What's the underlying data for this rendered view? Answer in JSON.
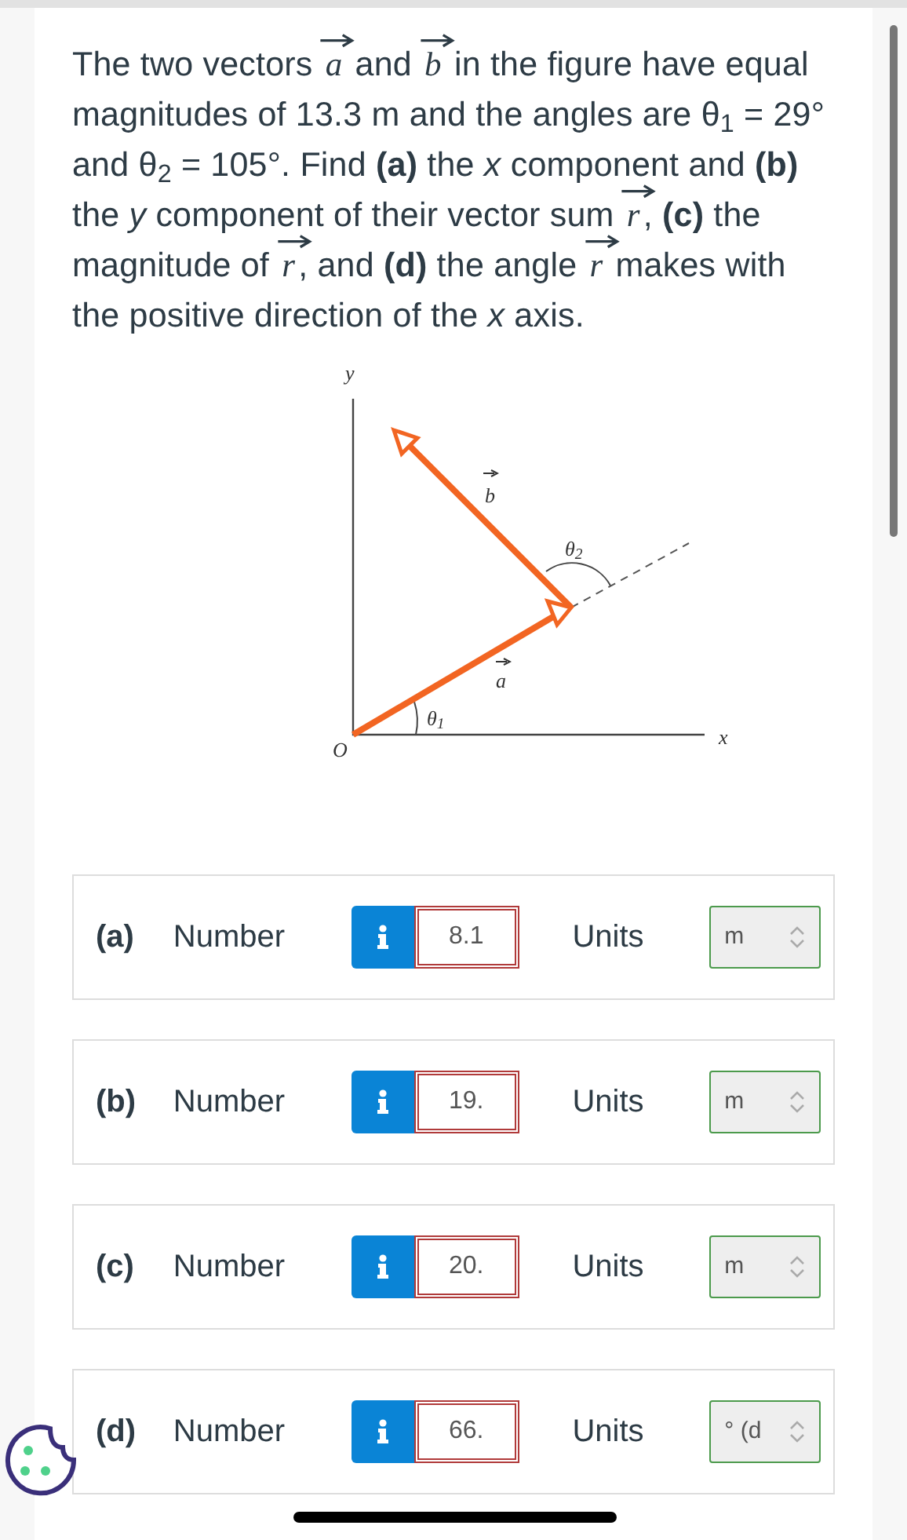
{
  "problem": [
    {
      "kind": "text",
      "text": "The two vectors "
    },
    {
      "kind": "vector",
      "symbol": "a"
    },
    {
      "kind": "text",
      "text": " and "
    },
    {
      "kind": "vector",
      "symbol": "b"
    },
    {
      "kind": "text",
      "text": " in the figure have equal magnitudes of 13.3 m and the angles are θ$_{1}$ = 29° and θ$_{2}$ = 105°. Find **(a)** the *x* component and **(b)** the *y* component of their vector sum "
    },
    {
      "kind": "vector",
      "symbol": "r"
    },
    {
      "kind": "text",
      "text": ", **(c)** the magnitude of "
    },
    {
      "kind": "vector",
      "symbol": "r"
    },
    {
      "kind": "text",
      "text": ", and **(d)** the angle "
    },
    {
      "kind": "vector",
      "symbol": "r"
    },
    {
      "kind": "text",
      "text": " makes with the positive direction of the *x* axis."
    }
  ],
  "figure": {
    "y_axis": "y",
    "x_axis": "x",
    "origin": "O",
    "vector_a": "a",
    "vector_b": "b",
    "angle_1": "θ$_{1}$",
    "angle_2": "θ$_{2}$"
  },
  "answers": [
    {
      "part": "(a)",
      "label": "Number",
      "value": "8.1",
      "units_label": "Units",
      "units": "m"
    },
    {
      "part": "(b)",
      "label": "Number",
      "value": "19.",
      "units_label": "Units",
      "units": "m"
    },
    {
      "part": "(c)",
      "label": "Number",
      "value": "20.",
      "units_label": "Units",
      "units": "m"
    },
    {
      "part": "(d)",
      "label": "Number",
      "value": "66.",
      "units_label": "Units",
      "units": "° (d"
    }
  ]
}
